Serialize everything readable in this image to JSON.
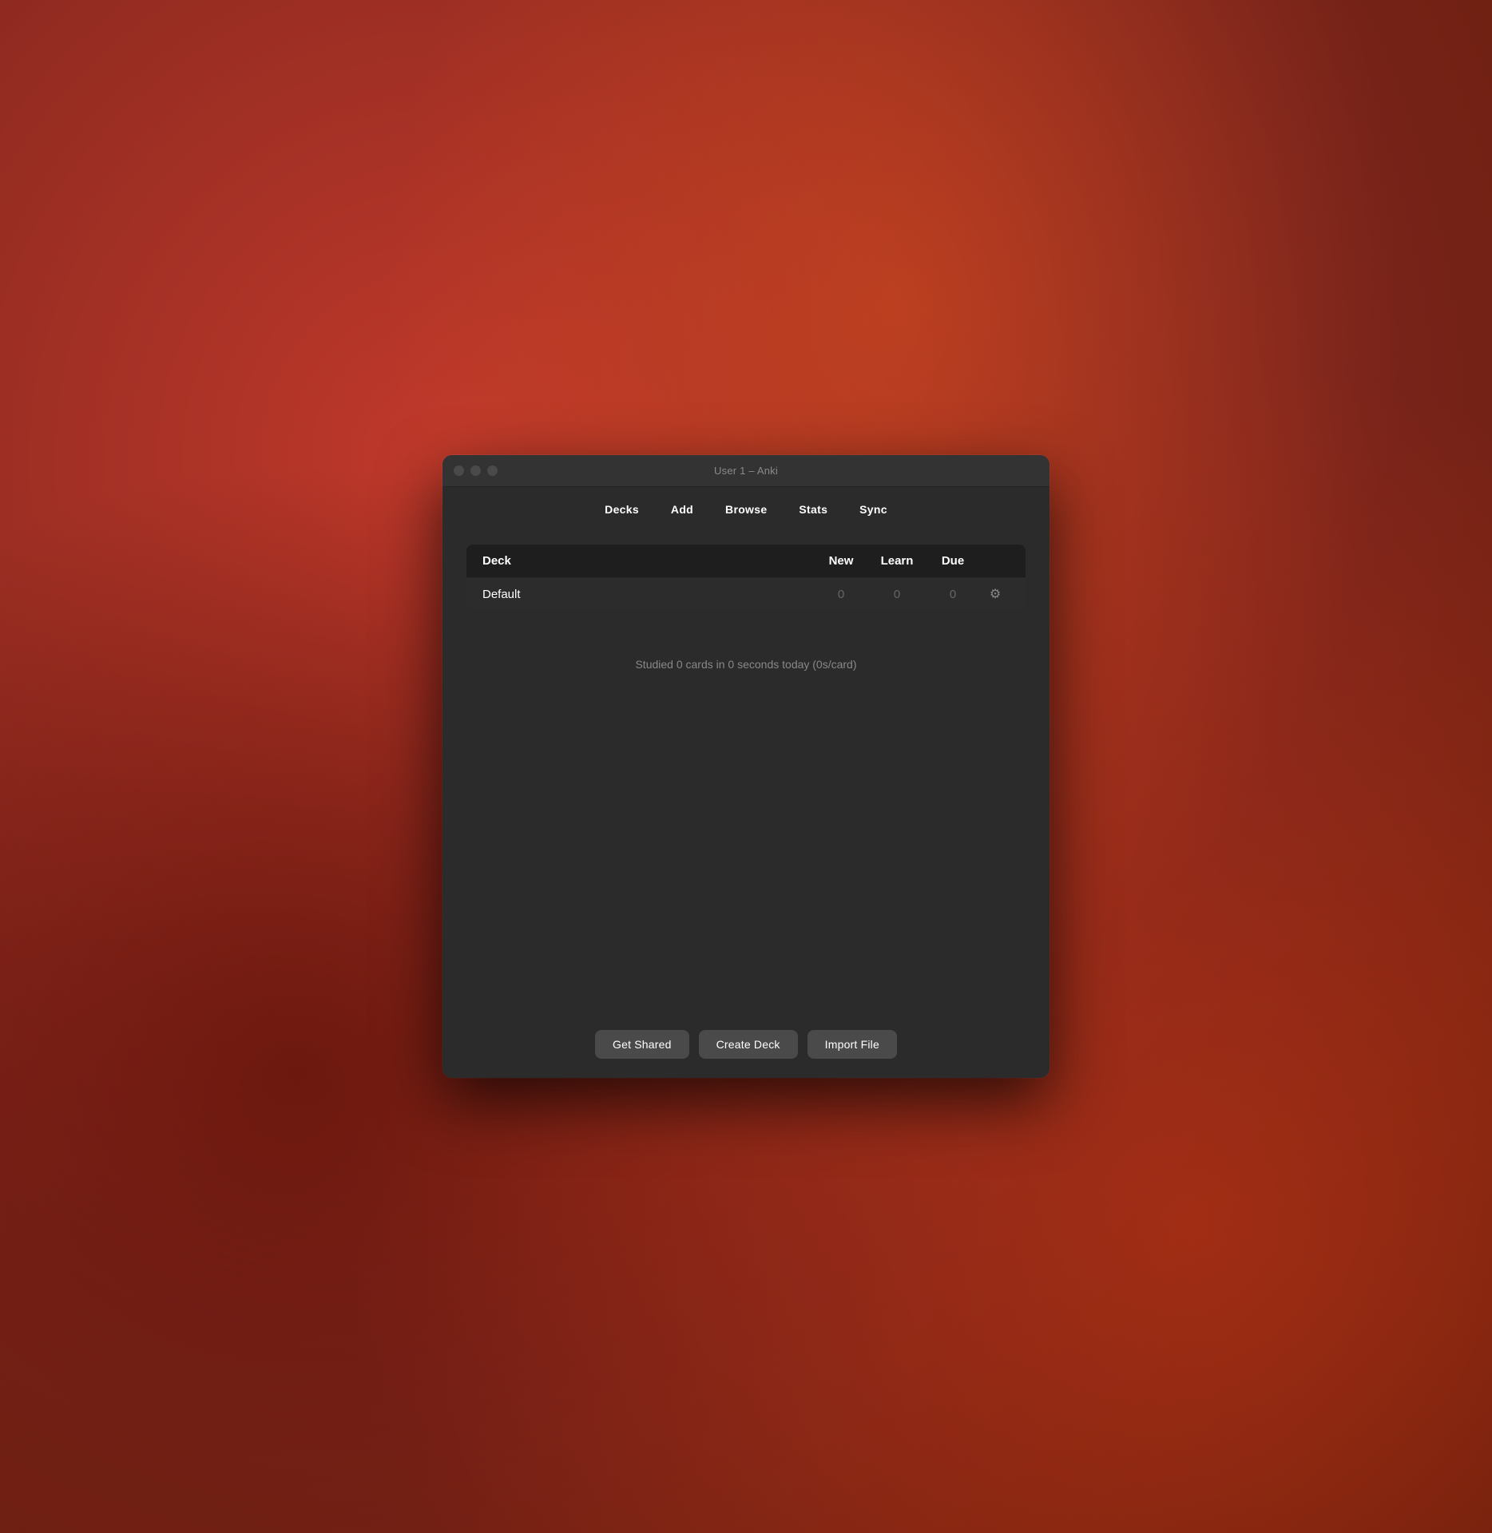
{
  "window": {
    "title": "User 1 – Anki"
  },
  "toolbar": {
    "items": [
      {
        "label": "Decks",
        "id": "decks"
      },
      {
        "label": "Add",
        "id": "add"
      },
      {
        "label": "Browse",
        "id": "browse"
      },
      {
        "label": "Stats",
        "id": "stats"
      },
      {
        "label": "Sync",
        "id": "sync"
      }
    ]
  },
  "table": {
    "headers": {
      "deck": "Deck",
      "new": "New",
      "learn": "Learn",
      "due": "Due"
    },
    "rows": [
      {
        "name": "Default",
        "new": "0",
        "learn": "0",
        "due": "0"
      }
    ]
  },
  "stats": {
    "text": "Studied 0 cards in 0 seconds today (0s/card)"
  },
  "buttons": {
    "get_shared": "Get Shared",
    "create_deck": "Create Deck",
    "import_file": "Import File"
  },
  "icons": {
    "gear": "⚙"
  }
}
